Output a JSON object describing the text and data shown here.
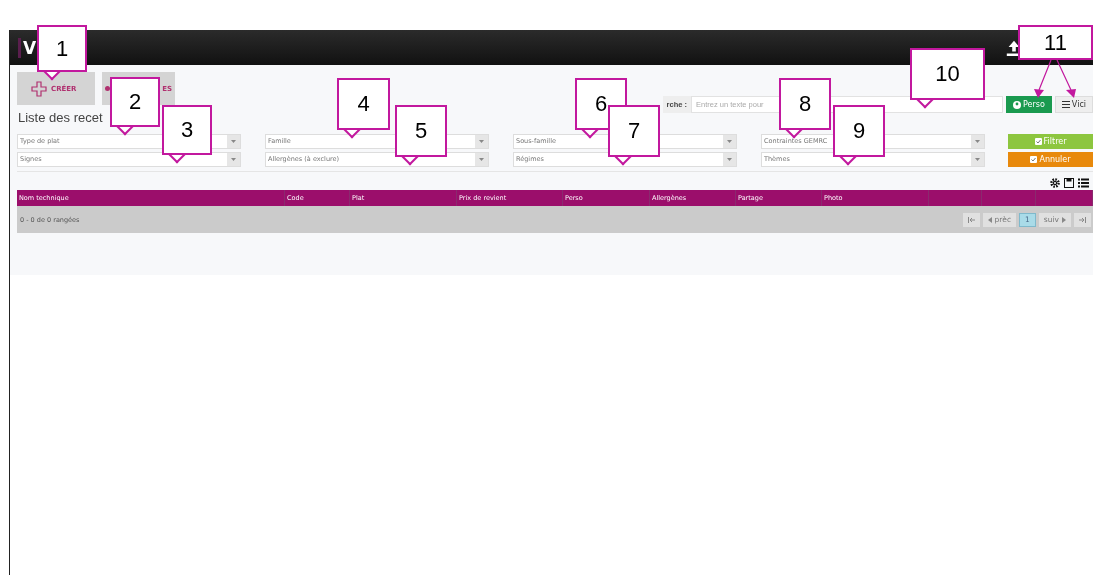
{
  "app_bar": {
    "logo": "V"
  },
  "toolbar": {
    "buttons": [
      {
        "label": "CRÉER",
        "kind": "create"
      },
      {
        "label": "ES",
        "kind": "other"
      }
    ]
  },
  "search": {
    "label": "rche :",
    "placeholder": "Entrez un texte pour",
    "views": [
      {
        "label": "Perso",
        "selected": true,
        "kind": "person"
      },
      {
        "label": "Vici",
        "selected": false,
        "kind": "list"
      }
    ]
  },
  "title": "Liste des recet",
  "filters": [
    {
      "placeholder": "Type de plat"
    },
    {
      "placeholder": "Famille"
    },
    {
      "placeholder": "Sous-famille"
    },
    {
      "placeholder": "Contraintes GEMRC"
    },
    {
      "placeholder": "Signes"
    },
    {
      "placeholder": "Allergènes (à exclure)"
    },
    {
      "placeholder": "Régimes"
    },
    {
      "placeholder": "Thèmes"
    }
  ],
  "actions": [
    {
      "label": "Filtrer",
      "kind": "apply"
    },
    {
      "label": "Annuler",
      "kind": "cancel"
    }
  ],
  "table": {
    "columns": [
      "Nom technique",
      "Code",
      "Plat",
      "Prix de revient",
      "Perso",
      "Allergènes",
      "Partage",
      "Photo"
    ],
    "summary": "0 - 0 de 0 rangées",
    "pager": [
      {
        "label": "prèc",
        "kind": "prev"
      },
      {
        "label": "1",
        "kind": "page",
        "selected": true
      },
      {
        "label": "suiv",
        "kind": "next"
      }
    ]
  },
  "callouts": [
    {
      "label": "1"
    },
    {
      "label": "2"
    },
    {
      "label": "3"
    },
    {
      "label": "4"
    },
    {
      "label": "5"
    },
    {
      "label": "6"
    },
    {
      "label": "7"
    },
    {
      "label": "8"
    },
    {
      "label": "9"
    },
    {
      "label": "10"
    },
    {
      "label": "11"
    }
  ]
}
